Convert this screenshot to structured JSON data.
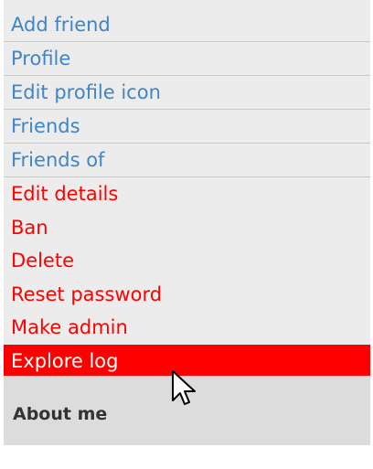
{
  "menu": {
    "items": [
      {
        "label": "Add friend"
      },
      {
        "label": "Profile"
      },
      {
        "label": "Edit profile icon"
      },
      {
        "label": "Friends"
      },
      {
        "label": "Friends of"
      },
      {
        "label": "Edit details"
      },
      {
        "label": "Ban"
      },
      {
        "label": "Delete"
      },
      {
        "label": "Reset password"
      },
      {
        "label": "Make admin"
      },
      {
        "label": "Explore log"
      }
    ]
  },
  "about": {
    "heading": "About me"
  },
  "colors": {
    "link": "#3f85c7",
    "admin_link": "#ff0000",
    "selected_bg": "#ff0000",
    "selected_text": "#ffffff",
    "panel_bg": "#ececec",
    "section_bg": "#dcdcdc"
  },
  "cursor": {
    "icon": "arrow-pointer-icon"
  }
}
